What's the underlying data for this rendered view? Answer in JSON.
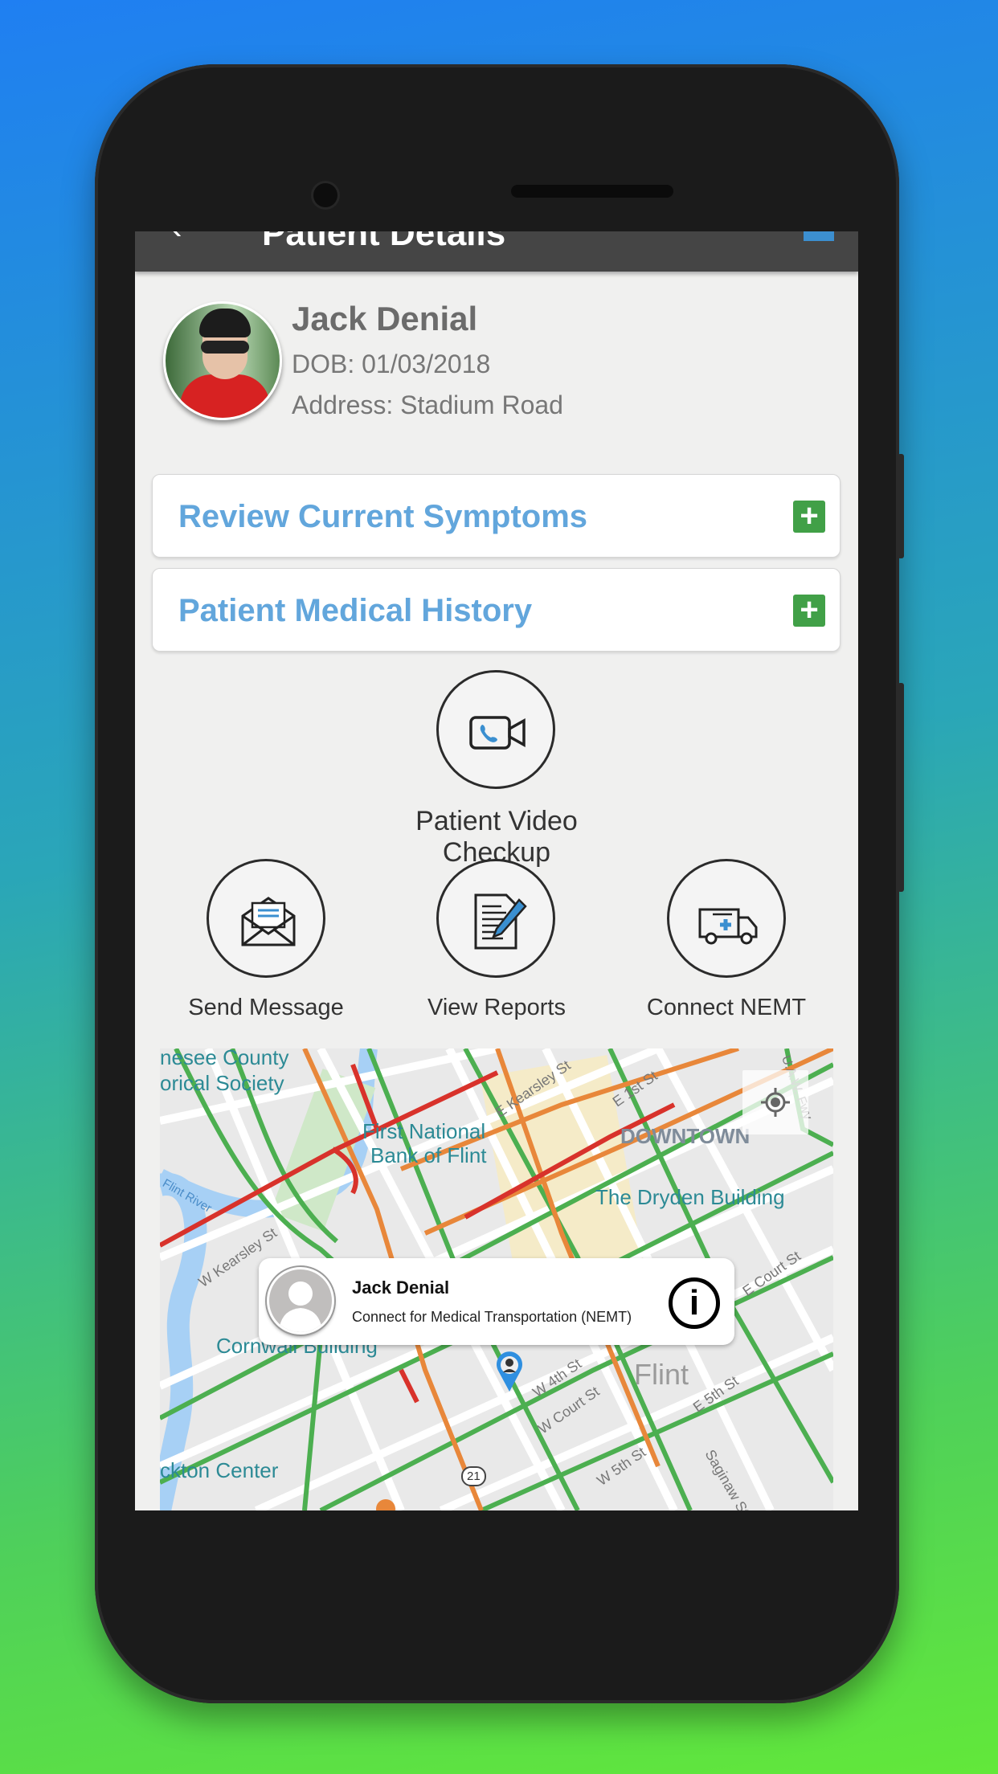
{
  "app_bar": {
    "title": "Patient Details",
    "back_icon": "back-arrow-icon",
    "action_icon": "add-icon"
  },
  "patient": {
    "name": "Jack Denial",
    "dob": "DOB: 01/03/2018",
    "address": "Address: Stadium Road"
  },
  "sections": [
    {
      "label": "Review Current Symptoms",
      "icon": "plus-icon"
    },
    {
      "label": "Patient Medical History",
      "icon": "plus-icon"
    }
  ],
  "video": {
    "label": "Patient Video Checkup",
    "icon": "video-call-icon"
  },
  "actions": [
    {
      "label": "Send Message",
      "icon": "envelope-icon"
    },
    {
      "label": "View Reports",
      "icon": "document-pen-icon"
    },
    {
      "label": "Connect NEMT",
      "icon": "ambulance-icon"
    }
  ],
  "map": {
    "labels": [
      "nesee County",
      "orical Society",
      "First National",
      "Bank of Flint",
      "DOWNTOWN",
      "The Dryden Building",
      "Cornwall Building",
      "ckton Center",
      "Flint",
      "Flint River",
      "E Kearsley St",
      "E 1st St",
      "W Kearsley St",
      "E Court St",
      "W 4th St",
      "W Court St",
      "E 5th St",
      "W 5th St",
      "Saginaw St",
      "U.A.W. Fwy",
      "21"
    ],
    "popup": {
      "name": "Jack Denial",
      "subtitle": "Connect for Medical Transportation (NEMT)",
      "icon": "info-icon"
    }
  },
  "colors": {
    "accent": "#62a6dc",
    "plus": "#41a047",
    "app_bar": "#454545",
    "traffic_green": "#4caf50",
    "traffic_orange": "#e8873a",
    "traffic_red": "#d8322b"
  }
}
